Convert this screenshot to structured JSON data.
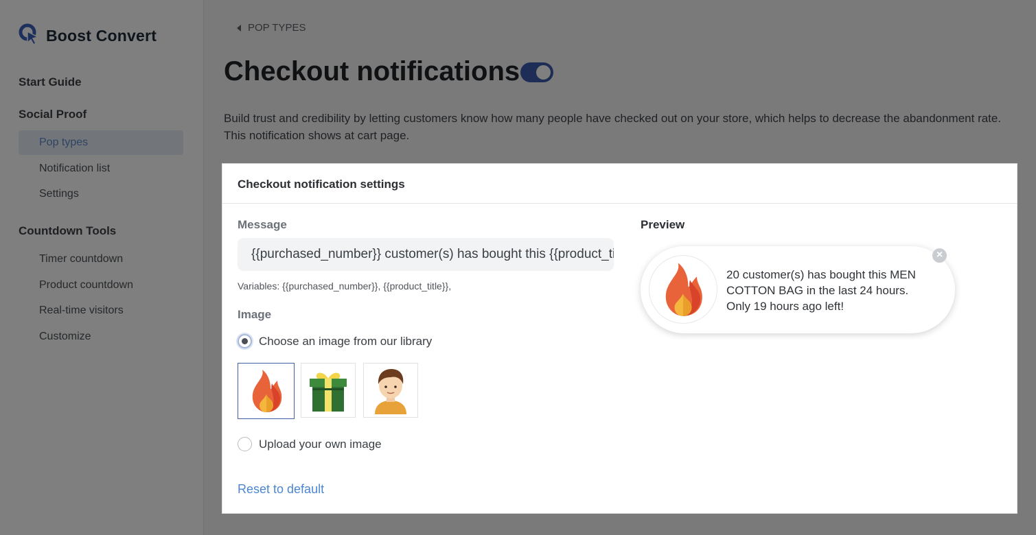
{
  "brand": {
    "name": "Boost Convert",
    "icon": "boost-convert-logo"
  },
  "sidebar": {
    "sections": [
      {
        "title": "Start Guide",
        "items": []
      },
      {
        "title": "Social Proof",
        "items": [
          {
            "label": "Pop types",
            "active": true
          },
          {
            "label": "Notification list",
            "active": false
          },
          {
            "label": "Settings",
            "active": false
          }
        ]
      },
      {
        "title": "Countdown Tools",
        "items": [
          {
            "label": "Timer countdown",
            "active": false
          },
          {
            "label": "Product countdown",
            "active": false
          },
          {
            "label": "Real-time visitors",
            "active": false
          },
          {
            "label": "Customize",
            "active": false
          }
        ]
      }
    ]
  },
  "breadcrumb": {
    "label": "POP TYPES",
    "icon": "chevron-left-icon"
  },
  "header": {
    "title": "Checkout notifications",
    "enabled": true,
    "description": "Build trust and credibility by letting customers know how many people have checked out on your store, which helps to decrease the abandonment rate. This notification shows at cart page."
  },
  "card": {
    "title": "Checkout notification settings",
    "message": {
      "label": "Message",
      "value": "{{purchased_number}} customer(s) has bought this {{product_title}} in the last {{time}}",
      "variables": "Variables: {{purchased_number}}, {{product_title}},"
    },
    "image": {
      "label": "Image",
      "library_option": "Choose an image from our library",
      "upload_option": "Upload your own image",
      "selected": "library",
      "thumbnails": [
        "fire-icon",
        "gift-icon",
        "person-avatar-icon"
      ],
      "selected_thumbnail": "fire-icon"
    },
    "reset_label": "Reset to default",
    "preview": {
      "label": "Preview",
      "text": "20 customer(s) has bought this MEN COTTON BAG in the last 24 hours. Only 19 hours ago left!",
      "close_icon": "close-icon"
    }
  },
  "colors": {
    "accent": "#3a5bab",
    "link": "#4b86d1",
    "active_bg": "#e4ecf7"
  }
}
